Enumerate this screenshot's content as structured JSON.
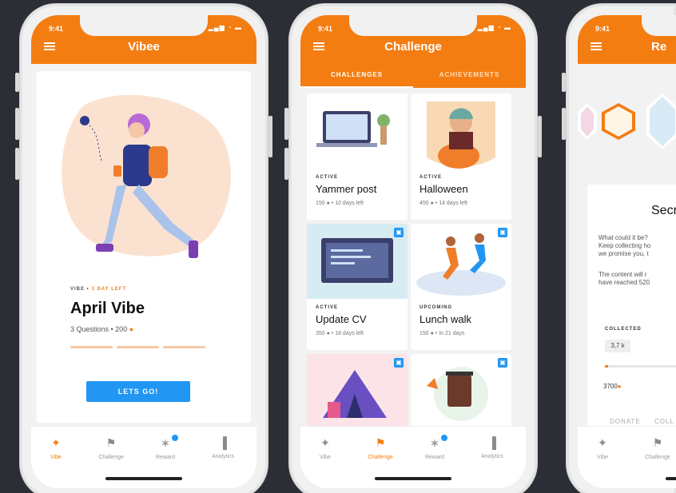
{
  "colors": {
    "accent": "#f47d12",
    "primary_button": "#2196f3",
    "background": "#2b2f35"
  },
  "phones": [
    {
      "time": "9:41",
      "status": "▂▄▆ ◔ ▬",
      "title": "Vibee"
    },
    {
      "time": "9:41",
      "status": "▂▄▆ ◔ ▬",
      "title": "Challenge"
    },
    {
      "time": "9:41",
      "status": "",
      "title": "Re"
    }
  ],
  "vibe": {
    "meta_prefix": "VIBE • ",
    "meta_highlight": "1 DAY LEFT",
    "title": "April Vibe",
    "questions": "3 Questions • 200",
    "coin": "●",
    "button": "LETS GO!"
  },
  "challenge": {
    "tabs": [
      "CHALLENGES",
      "ACHIEVEMENTS"
    ],
    "cards": [
      {
        "status": "ACTIVE",
        "name": "Yammer post",
        "info": "150 ● • 10 days left",
        "locked": false
      },
      {
        "status": "ACTIVE",
        "name": "Halloween",
        "info": "450 ● • 14 days left",
        "locked": false
      },
      {
        "status": "ACTIVE",
        "name": "Update CV",
        "info": "350 ● • 18 days left",
        "locked": true
      },
      {
        "status": "UPCOMING",
        "name": "Lunch walk",
        "info": "150 ● • In 21 days",
        "locked": true
      },
      {
        "status": "",
        "name": "",
        "info": "",
        "locked": true
      },
      {
        "status": "",
        "name": "",
        "info": "",
        "locked": true
      }
    ],
    "lock_icon": "▣"
  },
  "reward": {
    "title": "Secre",
    "p1": [
      "What could it be?",
      "Keep collecting ho",
      "we promise you, t"
    ],
    "p2": [
      "The content will r",
      "have reached 520"
    ],
    "collected_label": "COLLECTED",
    "collected_value": "3,7 k",
    "progress": 0.04,
    "amount": "3700",
    "links": [
      "DONATE",
      "COLL"
    ]
  },
  "nav": {
    "items": [
      {
        "label": "Vibe",
        "icon": "✦"
      },
      {
        "label": "Challenge",
        "icon": "⚑"
      },
      {
        "label": "Reward",
        "icon": "∗"
      },
      {
        "label": "Analytics",
        "icon": "▐"
      }
    ],
    "phone3_items": [
      {
        "label": "Vibe",
        "icon": "✦"
      },
      {
        "label": "Challenge",
        "icon": "⚑"
      }
    ]
  }
}
